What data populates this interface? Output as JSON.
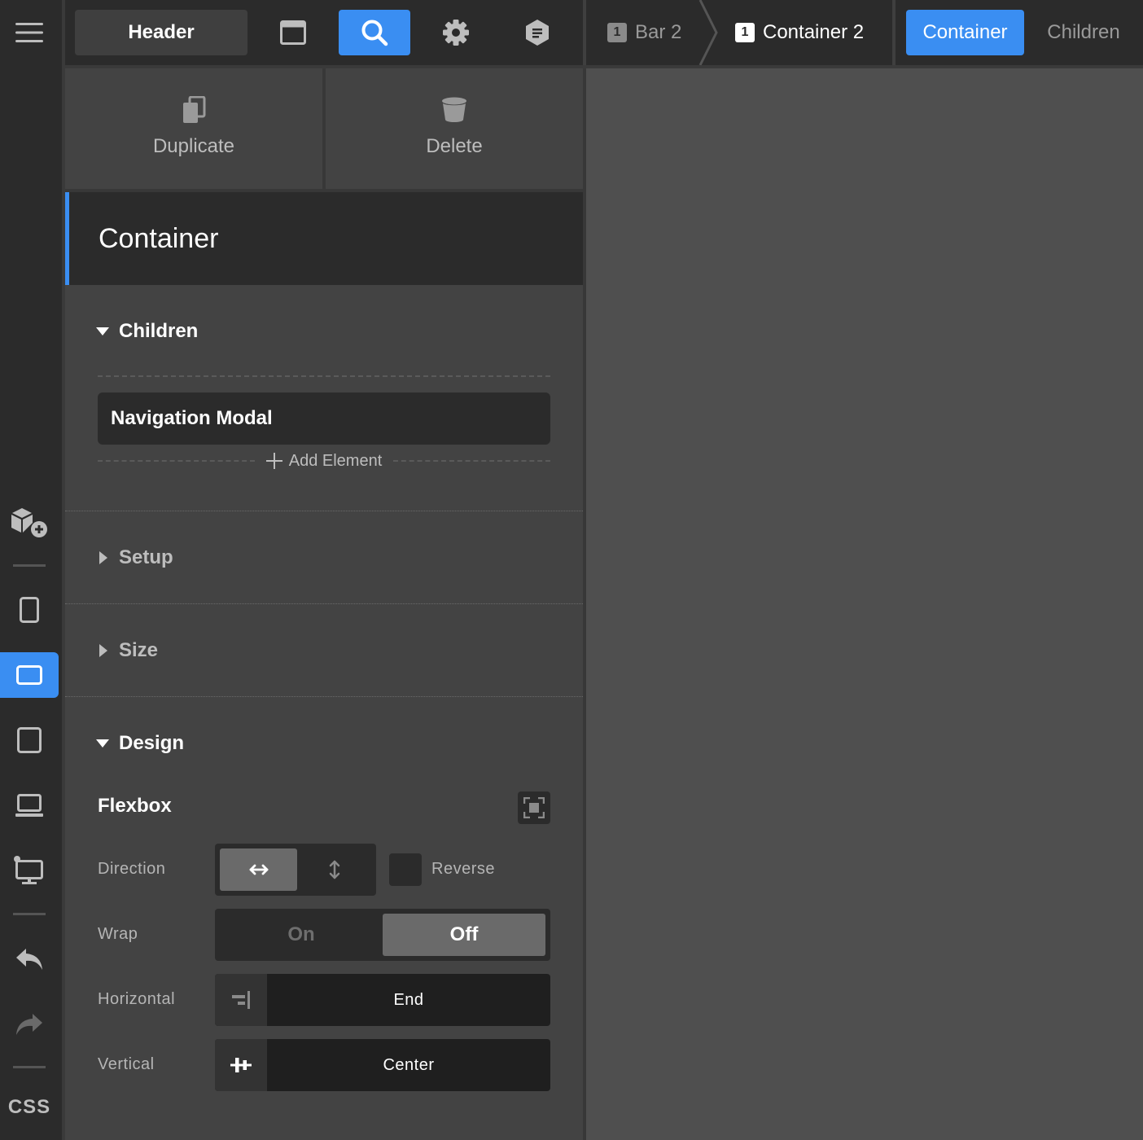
{
  "toolbar": {
    "header_label": "Header",
    "window_icon": "window-icon",
    "search_icon": "search-icon",
    "settings_icon": "gear-icon",
    "notes_icon": "notes-icon",
    "accent_color": "#3a8ef2"
  },
  "breadcrumb": {
    "items": [
      {
        "num": "1",
        "label": "Bar 2"
      },
      {
        "num": "1",
        "label": "Container 2"
      }
    ]
  },
  "panel_tabs": {
    "tabs": [
      {
        "label": "Container",
        "active": true
      },
      {
        "label": "Children",
        "active": false
      }
    ]
  },
  "actions": {
    "duplicate": "Duplicate",
    "delete": "Delete"
  },
  "element": {
    "title": "Container"
  },
  "sections": {
    "children": {
      "title": "Children",
      "expanded": true,
      "items": [
        "Navigation Modal"
      ],
      "add_label": "Add Element"
    },
    "setup": {
      "title": "Setup",
      "expanded": false
    },
    "size": {
      "title": "Size",
      "expanded": false
    },
    "design": {
      "title": "Design",
      "expanded": true
    }
  },
  "flexbox": {
    "title": "Flexbox",
    "direction_label": "Direction",
    "direction_value": "horizontal",
    "reverse_label": "Reverse",
    "reverse_checked": false,
    "wrap_label": "Wrap",
    "wrap_on": "On",
    "wrap_off": "Off",
    "wrap_value": "Off",
    "horizontal_label": "Horizontal",
    "horizontal_value": "End",
    "vertical_label": "Vertical",
    "vertical_value": "Center"
  },
  "rail": {
    "items": [
      {
        "icon": "menu-icon"
      },
      {
        "icon": "add-element-icon"
      },
      {
        "icon": "phone-icon"
      },
      {
        "icon": "tablet-landscape-icon",
        "active": true
      },
      {
        "icon": "tablet-icon"
      },
      {
        "icon": "laptop-icon"
      },
      {
        "icon": "desktop-icon"
      },
      {
        "icon": "undo-icon"
      },
      {
        "icon": "redo-icon"
      }
    ],
    "css_label": "CSS"
  }
}
